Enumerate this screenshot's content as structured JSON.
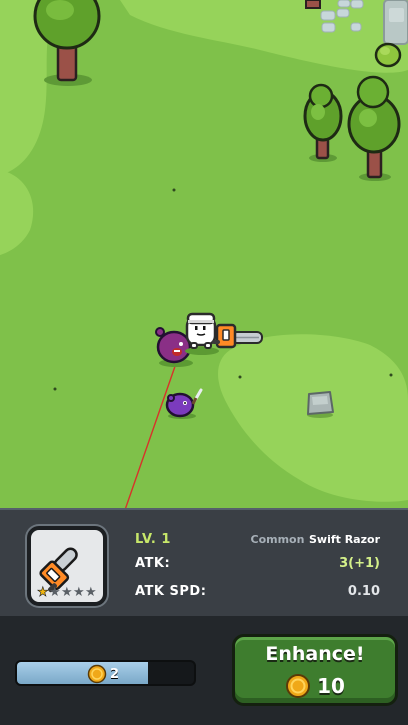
{
  "weapon": {
    "level": "LV. 1",
    "rarity": "Common",
    "name": "Swift Razor",
    "atk_label": "ATK:",
    "atk_value": "3(+1)",
    "atk_spd_label": "ATK SPD:",
    "atk_spd_value": "0.10",
    "stars_filled": 1,
    "stars_total": 5
  },
  "coins": {
    "amount": "2",
    "fill_fraction": 0.74
  },
  "enhance": {
    "label": "Enhance!",
    "cost": "10"
  },
  "colors": {
    "grass": "#7fc14a",
    "grass_light": "#9bd65e",
    "enhance_green": "#3e7d2e",
    "coin_gold": "#f0a818"
  }
}
